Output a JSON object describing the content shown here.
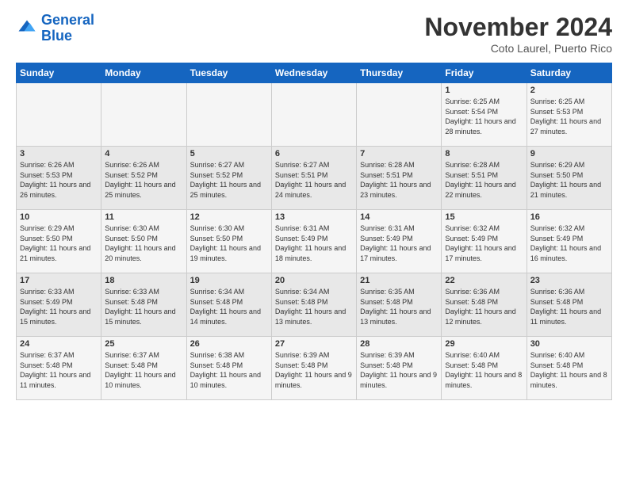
{
  "logo": {
    "line1": "General",
    "line2": "Blue"
  },
  "title": "November 2024",
  "location": "Coto Laurel, Puerto Rico",
  "days_of_week": [
    "Sunday",
    "Monday",
    "Tuesday",
    "Wednesday",
    "Thursday",
    "Friday",
    "Saturday"
  ],
  "weeks": [
    [
      {
        "day": "",
        "info": ""
      },
      {
        "day": "",
        "info": ""
      },
      {
        "day": "",
        "info": ""
      },
      {
        "day": "",
        "info": ""
      },
      {
        "day": "",
        "info": ""
      },
      {
        "day": "1",
        "info": "Sunrise: 6:25 AM\nSunset: 5:54 PM\nDaylight: 11 hours and 28 minutes."
      },
      {
        "day": "2",
        "info": "Sunrise: 6:25 AM\nSunset: 5:53 PM\nDaylight: 11 hours and 27 minutes."
      }
    ],
    [
      {
        "day": "3",
        "info": "Sunrise: 6:26 AM\nSunset: 5:53 PM\nDaylight: 11 hours and 26 minutes."
      },
      {
        "day": "4",
        "info": "Sunrise: 6:26 AM\nSunset: 5:52 PM\nDaylight: 11 hours and 25 minutes."
      },
      {
        "day": "5",
        "info": "Sunrise: 6:27 AM\nSunset: 5:52 PM\nDaylight: 11 hours and 25 minutes."
      },
      {
        "day": "6",
        "info": "Sunrise: 6:27 AM\nSunset: 5:51 PM\nDaylight: 11 hours and 24 minutes."
      },
      {
        "day": "7",
        "info": "Sunrise: 6:28 AM\nSunset: 5:51 PM\nDaylight: 11 hours and 23 minutes."
      },
      {
        "day": "8",
        "info": "Sunrise: 6:28 AM\nSunset: 5:51 PM\nDaylight: 11 hours and 22 minutes."
      },
      {
        "day": "9",
        "info": "Sunrise: 6:29 AM\nSunset: 5:50 PM\nDaylight: 11 hours and 21 minutes."
      }
    ],
    [
      {
        "day": "10",
        "info": "Sunrise: 6:29 AM\nSunset: 5:50 PM\nDaylight: 11 hours and 21 minutes."
      },
      {
        "day": "11",
        "info": "Sunrise: 6:30 AM\nSunset: 5:50 PM\nDaylight: 11 hours and 20 minutes."
      },
      {
        "day": "12",
        "info": "Sunrise: 6:30 AM\nSunset: 5:50 PM\nDaylight: 11 hours and 19 minutes."
      },
      {
        "day": "13",
        "info": "Sunrise: 6:31 AM\nSunset: 5:49 PM\nDaylight: 11 hours and 18 minutes."
      },
      {
        "day": "14",
        "info": "Sunrise: 6:31 AM\nSunset: 5:49 PM\nDaylight: 11 hours and 17 minutes."
      },
      {
        "day": "15",
        "info": "Sunrise: 6:32 AM\nSunset: 5:49 PM\nDaylight: 11 hours and 17 minutes."
      },
      {
        "day": "16",
        "info": "Sunrise: 6:32 AM\nSunset: 5:49 PM\nDaylight: 11 hours and 16 minutes."
      }
    ],
    [
      {
        "day": "17",
        "info": "Sunrise: 6:33 AM\nSunset: 5:49 PM\nDaylight: 11 hours and 15 minutes."
      },
      {
        "day": "18",
        "info": "Sunrise: 6:33 AM\nSunset: 5:48 PM\nDaylight: 11 hours and 15 minutes."
      },
      {
        "day": "19",
        "info": "Sunrise: 6:34 AM\nSunset: 5:48 PM\nDaylight: 11 hours and 14 minutes."
      },
      {
        "day": "20",
        "info": "Sunrise: 6:34 AM\nSunset: 5:48 PM\nDaylight: 11 hours and 13 minutes."
      },
      {
        "day": "21",
        "info": "Sunrise: 6:35 AM\nSunset: 5:48 PM\nDaylight: 11 hours and 13 minutes."
      },
      {
        "day": "22",
        "info": "Sunrise: 6:36 AM\nSunset: 5:48 PM\nDaylight: 11 hours and 12 minutes."
      },
      {
        "day": "23",
        "info": "Sunrise: 6:36 AM\nSunset: 5:48 PM\nDaylight: 11 hours and 11 minutes."
      }
    ],
    [
      {
        "day": "24",
        "info": "Sunrise: 6:37 AM\nSunset: 5:48 PM\nDaylight: 11 hours and 11 minutes."
      },
      {
        "day": "25",
        "info": "Sunrise: 6:37 AM\nSunset: 5:48 PM\nDaylight: 11 hours and 10 minutes."
      },
      {
        "day": "26",
        "info": "Sunrise: 6:38 AM\nSunset: 5:48 PM\nDaylight: 11 hours and 10 minutes."
      },
      {
        "day": "27",
        "info": "Sunrise: 6:39 AM\nSunset: 5:48 PM\nDaylight: 11 hours and 9 minutes."
      },
      {
        "day": "28",
        "info": "Sunrise: 6:39 AM\nSunset: 5:48 PM\nDaylight: 11 hours and 9 minutes."
      },
      {
        "day": "29",
        "info": "Sunrise: 6:40 AM\nSunset: 5:48 PM\nDaylight: 11 hours and 8 minutes."
      },
      {
        "day": "30",
        "info": "Sunrise: 6:40 AM\nSunset: 5:48 PM\nDaylight: 11 hours and 8 minutes."
      }
    ]
  ]
}
